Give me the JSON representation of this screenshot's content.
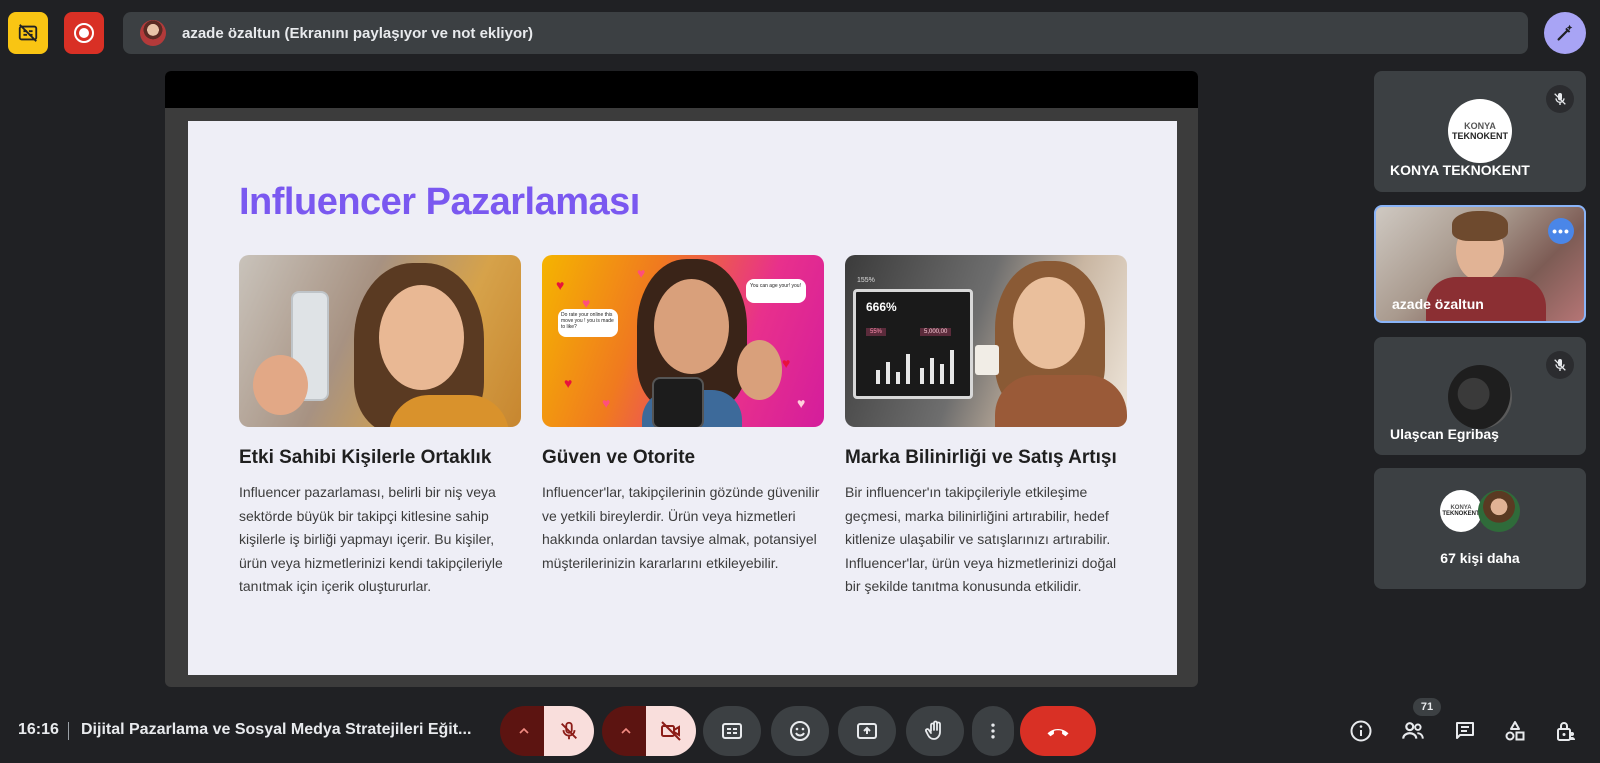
{
  "top_bar": {
    "presenter_text": "azade özaltun (Ekranını paylaşıyor ve not ekliyor)"
  },
  "slide": {
    "title": "Influencer Pazarlaması",
    "image_texts": {
      "bubble_1": "Do rate your online this move you ! you is made to like?",
      "bubble_2": "You can age your! you!",
      "stat_big": "666%",
      "stat_small": "155%",
      "stat_mid": "55%",
      "stat_right": "5,000,00"
    },
    "columns": [
      {
        "heading": "Etki Sahibi Kişilerle Ortaklık",
        "body": "Influencer pazarlaması, belirli bir niş veya sektörde büyük bir takipçi kitlesine sahip kişilerle iş birliği yapmayı içerir. Bu kişiler, ürün veya hizmetlerinizi kendi takipçileriyle tanıtmak için içerik oluştururlar."
      },
      {
        "heading": "Güven ve Otorite",
        "body": "Influencer'lar, takipçilerinin gözünde güvenilir ve yetkili bireylerdir. Ürün veya hizmetleri hakkında onlardan tavsiye almak, potansiyel müşterilerinizin kararlarını etkileyebilir."
      },
      {
        "heading": "Marka Bilinirliği ve Satış Artışı",
        "body": "Bir influencer'ın takipçileriyle etkileşime geçmesi, marka bilinirliğini artırabilir, hedef kitlenize ulaşabilir ve satışlarınızı artırabilir. Influencer'lar, ürün veya hizmetlerinizi doğal bir şekilde tanıtma konusunda etkilidir."
      }
    ]
  },
  "participants": {
    "tile_1": {
      "name": "KONYA TEKNOKENT",
      "logo_top": "KONYA",
      "logo_bottom": "TEKNOKENT"
    },
    "tile_2": {
      "name": "azade özaltun"
    },
    "tile_3": {
      "name": "Ulaşcan Egribaş"
    },
    "tile_4": {
      "more_label": "67 kişi daha",
      "logo_top": "KONYA",
      "logo_bottom": "TEKNOKENT"
    }
  },
  "bottom_bar": {
    "time": "16:16",
    "meeting_title": "Dijital Pazarlama ve Sosyal Medya Stratejileri Eğit...",
    "people_count": "71"
  },
  "colors": {
    "accent_title": "#7a58f0",
    "end_call": "#d93025",
    "active_tile_border": "#8ab4f8"
  }
}
